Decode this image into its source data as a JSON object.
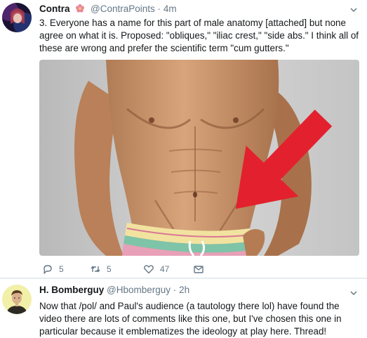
{
  "tweets": [
    {
      "name": "Contra",
      "handle": "@ContraPoints",
      "dot": "·",
      "time": "4m",
      "text": "3. Everyone has a name for this part of male anatomy [attached] but none agree on what it is. Proposed: \"obliques,\" \"iliac crest,\" \"side abs.\" I think all of these are wrong and prefer the scientific term \"cum gutters.\"",
      "replies": "5",
      "retweets": "5",
      "likes": "47",
      "media": "shirtless-torso-photo-with-red-arrow"
    },
    {
      "name": "H. Bomberguy",
      "handle": "@Hbomberguy",
      "dot": "·",
      "time": "2h",
      "text": "Now that /pol/ and Paul's audience (a tautology there lol) have found the video there are lots of comments like this one, but I've chosen this one in particular because it emblematizes the ideology at play here. Thread!"
    }
  ],
  "colors": {
    "text": "#14171a",
    "secondary": "#657786",
    "background": "#e6ecf0",
    "arrow": "#e3212e",
    "flower": "#e9879c"
  }
}
